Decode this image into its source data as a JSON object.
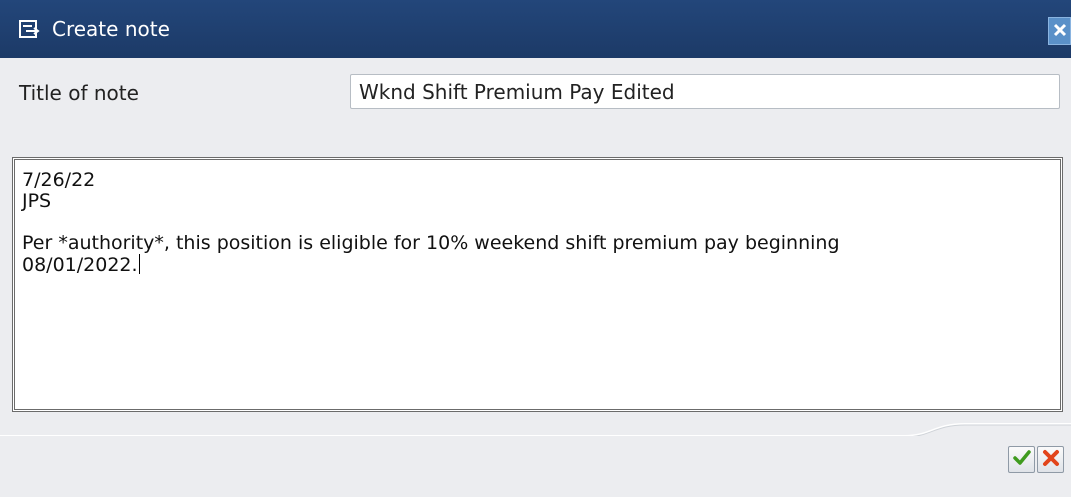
{
  "window": {
    "title": "Create note",
    "icons": {
      "title": "edit-note-icon",
      "close": "close-icon"
    }
  },
  "form": {
    "title_label": "Title of note",
    "title_value": "Wknd Shift Premium Pay Edited"
  },
  "editor": {
    "lines": [
      "7/26/22",
      "JPS",
      "",
      "Per *authority*, this position is eligible for 10% weekend shift premium pay beginning",
      "08/01/2022."
    ]
  },
  "footer": {
    "icons": {
      "confirm": "checkmark-icon",
      "cancel": "cancel-icon"
    },
    "colors": {
      "confirm": "#3f9b1e",
      "cancel": "#e2451b"
    }
  },
  "colors": {
    "titlebar": "#1f3f70",
    "background": "#ecedf0",
    "close_button": "#5a90c8"
  }
}
